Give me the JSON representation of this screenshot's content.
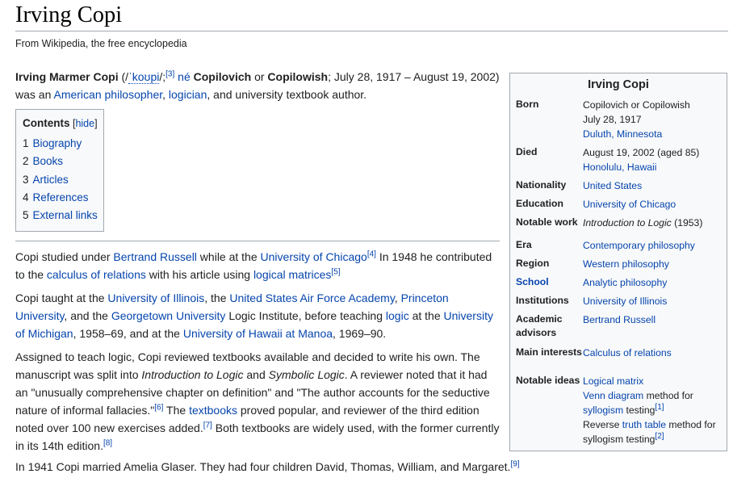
{
  "page": {
    "title": "Irving Copi",
    "tagline": "From Wikipedia, the free encyclopedia"
  },
  "intro": {
    "name_bold": "Irving Marmer Copi",
    "pron_open": " (/",
    "pron_link": "ˈkoʊpi",
    "pron_close": "/;",
    "ref3": "[3]",
    "ne_link": "né",
    "name2_bold": "Copilovich",
    "or_text": " or ",
    "name3_bold": "Copilowish",
    "dates": "; July 28, 1917 – August 19, 2002)",
    "was_an": " was an ",
    "link_philosopher": "American philosopher",
    "comma": ", ",
    "link_logician": "logician",
    "tail": ", and university textbook author."
  },
  "toc": {
    "heading": "Contents",
    "hide_open": " [",
    "hide_label": "hide",
    "hide_close": "]",
    "items": [
      {
        "num": "1",
        "label": "Biography"
      },
      {
        "num": "2",
        "label": "Books"
      },
      {
        "num": "3",
        "label": "Articles"
      },
      {
        "num": "4",
        "label": "References"
      },
      {
        "num": "5",
        "label": "External links"
      }
    ]
  },
  "p1": {
    "t1": "Copi studied under ",
    "l1": "Bertrand Russell",
    "t2": " while at the ",
    "l2": "University of Chicago",
    "r1": "[4]",
    "t3": " In 1948 he contributed to the ",
    "l3": "calculus of relations",
    "t4": " with his article using ",
    "l4": "logical matrices",
    "r2": "[5]"
  },
  "p2": {
    "t1": "Copi taught at the ",
    "l1": "University of Illinois",
    "t2": ", the ",
    "l2": "United States Air Force Academy",
    "t3": ", ",
    "l3": "Princeton University",
    "t4": ", and the ",
    "l4": "Georgetown University",
    "t5": " Logic Institute, before teaching ",
    "l5": "logic",
    "t6": " at the ",
    "l6": "University of Michigan",
    "t7": ", 1958–69, and at the ",
    "l7": "University of Hawaii at Manoa",
    "t8": ", 1969–90."
  },
  "p3": {
    "t1": "Assigned to teach logic, Copi reviewed textbooks available and decided to write his own. The manuscript was split into ",
    "i1": "Introduction to Logic",
    "t2": " and ",
    "i2": "Symbolic Logic",
    "t3": ". A reviewer noted that it had an \"unusually comprehensive chapter on definition\" and \"The author accounts for the seductive nature of informal fallacies.\"",
    "r1": "[6]",
    "t4": " The ",
    "l1": "textbooks",
    "t5": " proved popular, and reviewer of the third edition noted over 100 new exercises added.",
    "r2": "[7]",
    "t6": " Both textbooks are widely used, with the former currently in its 14th edition.",
    "r3": "[8]"
  },
  "p4": {
    "t1": "In 1941 Copi married Amelia Glaser. They had four children David, Thomas, William, and Margaret.",
    "r1": "[9]"
  },
  "infobox": {
    "title": "Irving Copi",
    "born_label": "Born",
    "born_line1": "Copilovich or Copilowish",
    "born_line2": "July 28, 1917",
    "born_place": "Duluth, Minnesota",
    "died_label": "Died",
    "died_line1": "August 19, 2002 (aged 85)",
    "died_place": "Honolulu, Hawaii",
    "nationality_label": "Nationality",
    "nationality_value": "United States",
    "education_label": "Education",
    "education_value": "University of Chicago",
    "notable_work_label": "Notable work",
    "notable_work_title": "Introduction to Logic",
    "notable_work_year": " (1953)",
    "era_label": "Era",
    "era_value": "Contemporary philosophy",
    "region_label": "Region",
    "region_value": "Western philosophy",
    "school_label": "School",
    "school_value": "Analytic philosophy",
    "institutions_label": "Institutions",
    "institutions_value": "University of Illinois",
    "advisors_label": "Academic advisors",
    "advisors_value": "Bertrand Russell",
    "interests_label": "Main interests",
    "interests_value": "Calculus of relations",
    "ideas_label": "Notable ideas",
    "idea1": "Logical matrix",
    "idea2_link": "Venn diagram",
    "idea2_text": " method for ",
    "idea2_link2": "syllogism",
    "idea2_text2": " testing",
    "idea2_ref": "[1]",
    "idea3_text": "Reverse ",
    "idea3_link": "truth table",
    "idea3_text2": " method for syllogism testing",
    "idea3_ref": "[2]"
  }
}
